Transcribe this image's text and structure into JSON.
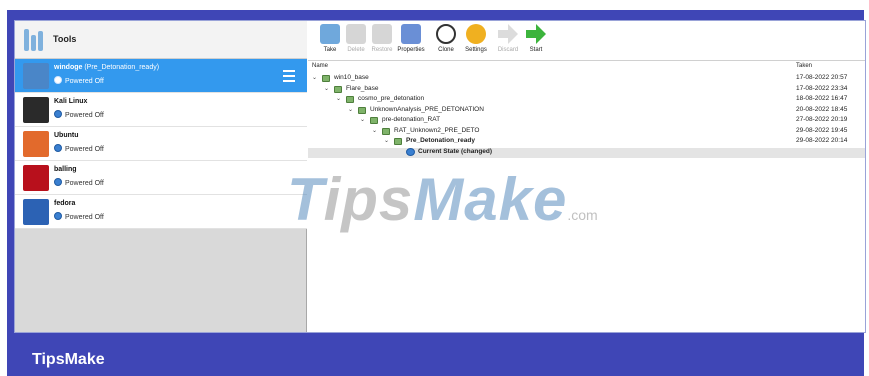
{
  "sidebar": {
    "tools_label": "Tools",
    "vms": [
      {
        "name": "windoge",
        "snapshot": "(Pre_Detonation_ready)",
        "state": "Powered Off",
        "selected": true,
        "icon": "windows-10-os-icon"
      },
      {
        "name": "Kali Linux",
        "snapshot": "",
        "state": "Powered Off",
        "selected": false,
        "icon": "linux-os-icon"
      },
      {
        "name": "Ubuntu",
        "snapshot": "",
        "state": "Powered Off",
        "selected": false,
        "icon": "ubuntu-os-icon"
      },
      {
        "name": "balling",
        "snapshot": "",
        "state": "Powered Off",
        "selected": false,
        "icon": "debian-os-icon"
      },
      {
        "name": "fedora",
        "snapshot": "",
        "state": "Powered Off",
        "selected": false,
        "icon": "fedora-os-icon"
      }
    ]
  },
  "toolbar": {
    "buttons": [
      {
        "label": "Take",
        "enabled": true,
        "icon": "take-snapshot-icon",
        "color": "#6fa8dc"
      },
      {
        "label": "Delete",
        "enabled": false,
        "icon": "delete-snapshot-icon",
        "color": "#d6d6d6"
      },
      {
        "label": "Restore",
        "enabled": false,
        "icon": "restore-snapshot-icon",
        "color": "#d6d6d6"
      },
      {
        "label": "Properties",
        "enabled": true,
        "icon": "properties-icon",
        "color": "#6a8fd6"
      },
      {
        "label": "Clone",
        "enabled": true,
        "icon": "clone-icon",
        "color": "#ffffff"
      },
      {
        "label": "Settings",
        "enabled": true,
        "icon": "gear-icon",
        "color": "#f0b020"
      },
      {
        "label": "Discard",
        "enabled": false,
        "icon": "discard-icon",
        "color": "#dcdcdc"
      },
      {
        "label": "Start",
        "enabled": true,
        "icon": "start-arrow-icon",
        "color": "#3cb43c"
      }
    ]
  },
  "snapshots": {
    "header_name": "Name",
    "header_taken": "Taken",
    "rows": [
      {
        "name": "win10_base",
        "taken": "17-08-2022 20:57",
        "depth": 0,
        "bold": false
      },
      {
        "name": "Flare_base",
        "taken": "17-08-2022 23:34",
        "depth": 1,
        "bold": false
      },
      {
        "name": "cosmo_pre_detonation",
        "taken": "18-08-2022 16:47",
        "depth": 2,
        "bold": false
      },
      {
        "name": "UnknownAnalysis_PRE_DETONATION",
        "taken": "20-08-2022 18:45",
        "depth": 3,
        "bold": false
      },
      {
        "name": "pre-detonation_RAT",
        "taken": "27-08-2022 20:19",
        "depth": 4,
        "bold": false
      },
      {
        "name": "RAT_Unknown2_PRE_DETO",
        "taken": "29-08-2022 19:45",
        "depth": 5,
        "bold": false
      },
      {
        "name": "Pre_Detonation_ready",
        "taken": "29-08-2022 20:14",
        "depth": 6,
        "bold": true
      },
      {
        "name": "Current State (changed)",
        "taken": "",
        "depth": 7,
        "bold": true,
        "current": true
      }
    ]
  },
  "watermark": {
    "main": "TipsMake",
    "suffix": ".com"
  },
  "footer": {
    "brand": "TipsMake"
  },
  "colors": {
    "frame": "#3f46b6",
    "selection": "#3399ee"
  }
}
